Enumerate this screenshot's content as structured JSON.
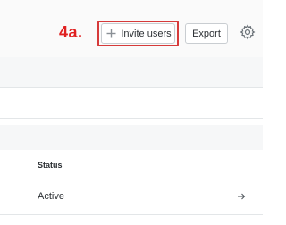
{
  "annotation": {
    "step_label": "4a."
  },
  "toolbar": {
    "invite_label": "Invite users",
    "invite_icon": "plus-icon",
    "export_label": "Export",
    "settings_icon": "gear-icon"
  },
  "table": {
    "columns": [
      "Status"
    ],
    "rows": [
      {
        "status": "Active",
        "action_icon": "arrow-right-icon"
      }
    ]
  },
  "colors": {
    "annotation_red": "#e02020",
    "highlight_border": "#d63a3a",
    "button_border": "#c9cdd1",
    "band_gray": "#f6f7f8",
    "divider": "#e3e6e8"
  }
}
